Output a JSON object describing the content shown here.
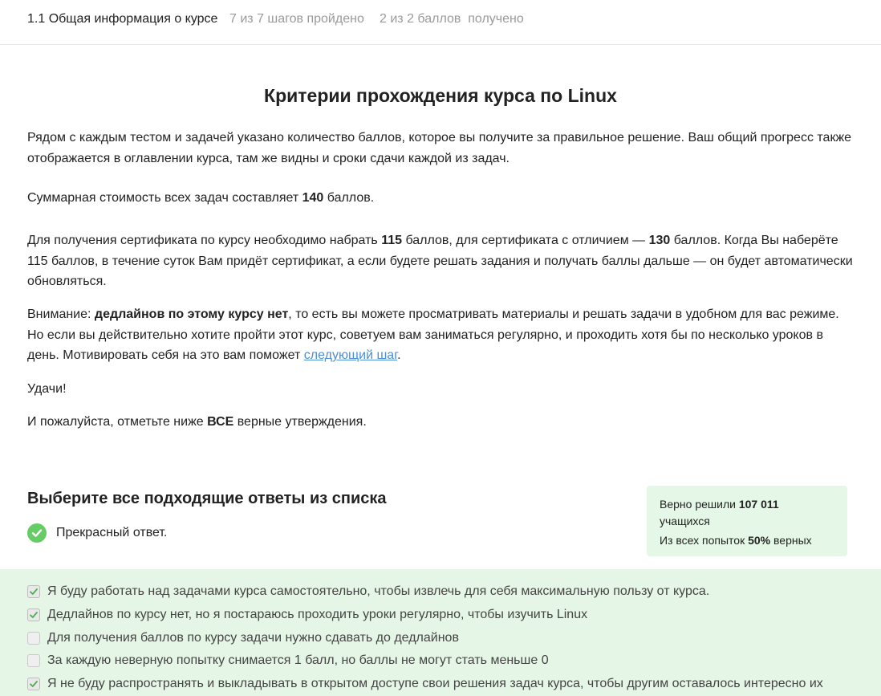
{
  "header": {
    "lesson_title": "1.1 Общая информация о курсе",
    "steps_progress": "7 из 7 шагов пройдено",
    "score_progress": "2 из 2 баллов  получено"
  },
  "article": {
    "title": "Критерии прохождения курса по Linux",
    "p1": "Рядом с каждым тестом и задачей указано количество баллов, которое вы получите за правильное решение. Ваш общий прогресс также отображается в оглавлении курса, там же видны и сроки сдачи каждой из задач.",
    "p2_a": "Суммарная стоимость всех задач составляет ",
    "p2_b": "140",
    "p2_c": " баллов.",
    "p3_a": "Для получения сертификата по курсу необходимо набрать ",
    "p3_b": "115",
    "p3_c": " баллов, для сертификата с отличием — ",
    "p3_d": "130",
    "p3_e": " баллов. Когда Вы наберёте 115 баллов, в течение суток Вам придёт сертификат, а если будете решать задания и получать баллы дальше — он будет автоматически обновляться.",
    "p4_a": "Внимание: ",
    "p4_b": "дедлайнов по этому курсу нет",
    "p4_c": ", то есть вы можете просматривать материалы и решать задачи в удобном для вас режиме. Но если вы действительно хотите пройти этот курс, советуем вам заниматься регулярно, и проходить хотя бы по несколько уроков в день. Мотивировать себя на это вам поможет ",
    "p4_link": "следующий шаг",
    "p4_d": ".",
    "p5": "Удачи!",
    "p6_a": "И пожалуйста, отметьте ниже ",
    "p6_b": "ВСЕ",
    "p6_c": " верные утверждения."
  },
  "quiz": {
    "title": "Выберите все подходящие ответы из списка",
    "feedback": "Прекрасный ответ.",
    "stats_line1_a": "Верно решили ",
    "stats_line1_b": "107 011",
    "stats_line1_c": "учащихся",
    "stats_line2_a": "Из всех попыток ",
    "stats_line2_b": "50%",
    "stats_line2_c": " верных",
    "options": [
      {
        "label": "Я буду работать над задачами курса самостоятельно, чтобы извлечь для себя максимальную пользу от курса.",
        "checked": true
      },
      {
        "label": "Дедлайнов по курсу нет, но я постараюсь проходить уроки регулярно, чтобы изучить Linux",
        "checked": true
      },
      {
        "label": "Для получения баллов по курсу задачи нужно сдавать до дедлайнов",
        "checked": false
      },
      {
        "label": "За каждую неверную попытку снимается 1 балл, но баллы не могут стать меньше 0",
        "checked": false
      },
      {
        "label": "Я не буду распространять и выкладывать в открытом доступе свои решения задач курса, чтобы другим оставалось интересно их",
        "checked": true
      }
    ]
  },
  "colors": {
    "accent_green": "#66cc66",
    "feedback_bg": "#e6f6e6",
    "link": "#4a8fd8"
  }
}
